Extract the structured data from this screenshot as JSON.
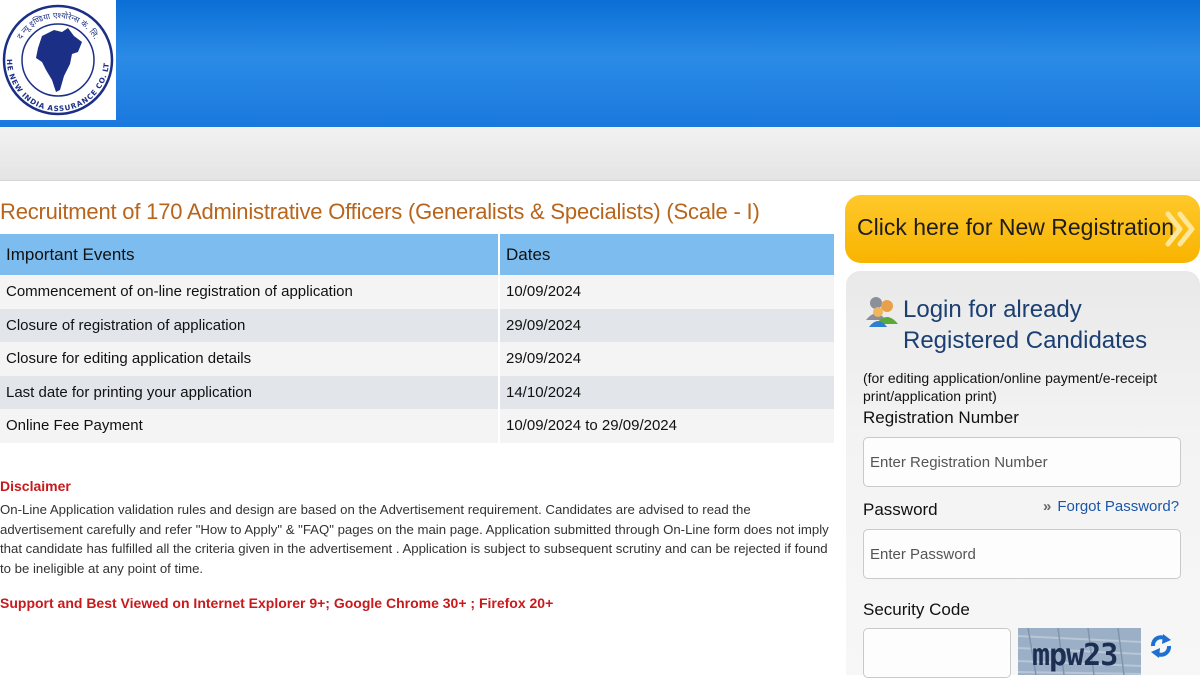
{
  "header": {
    "logo": {
      "icon": "new-india-assurance-emblem",
      "text_top": "द न्यू इण्डिया एश्योरेन्स कं. लि.",
      "text_bottom": "THE NEW INDIA ASSURANCE CO. LTD."
    }
  },
  "main": {
    "title": "Recruitment of 170 Administrative Officers (Generalists & Specialists) (Scale - I)",
    "table": {
      "headers": [
        "Important Events",
        "Dates"
      ],
      "rows": [
        [
          "Commencement of on-line registration of application",
          "10/09/2024"
        ],
        [
          "Closure of registration of application",
          "29/09/2024"
        ],
        [
          "Closure for editing application details",
          "29/09/2024"
        ],
        [
          "Last date for printing your application",
          "14/10/2024"
        ],
        [
          "Online Fee Payment",
          "10/09/2024 to 29/09/2024"
        ]
      ]
    },
    "disclaimer": {
      "title": "Disclaimer",
      "text": "On-Line Application validation rules and design are based on the Advertisement requirement. Candidates are advised to read the advertisement carefully and refer \"How to Apply\" & \"FAQ\" pages on the main page. Application submitted through On-Line form does not imply that candidate has fulfilled all the criteria given in the advertisement . Application is subject to subsequent scrutiny and can be rejected if found to be ineligible at any point of time."
    },
    "support": "Support and Best Viewed on Internet Explorer 9+; Google Chrome 30+ ; Firefox 20+"
  },
  "sidebar": {
    "register_button": "Click here for New Registration",
    "login": {
      "title_line1": "Login for already",
      "title_line2": "Registered Candidates",
      "note": "(for editing application/online payment/e-receipt print/application print)",
      "reg_label": "Registration Number",
      "reg_placeholder": "Enter Registration Number",
      "password_label": "Password",
      "forgot_link": "Forgot Password?",
      "password_placeholder": "Enter Password",
      "security_label": "Security Code",
      "captcha_text": "mpw23"
    }
  },
  "colors": {
    "header_blue": "#1a78de",
    "title_orange": "#b8641b",
    "table_header": "#7cbcee",
    "alert_red": "#c8191c",
    "register_yellow": "#f8b400",
    "login_title": "#1c3f72"
  }
}
